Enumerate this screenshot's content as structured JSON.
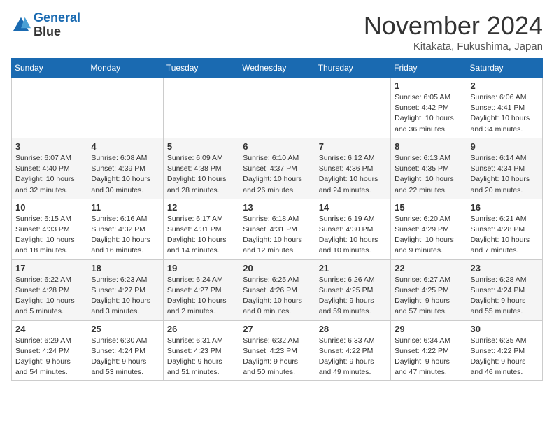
{
  "logo": {
    "line1": "General",
    "line2": "Blue"
  },
  "title": "November 2024",
  "location": "Kitakata, Fukushima, Japan",
  "days_of_week": [
    "Sunday",
    "Monday",
    "Tuesday",
    "Wednesday",
    "Thursday",
    "Friday",
    "Saturday"
  ],
  "weeks": [
    [
      {
        "day": "",
        "info": ""
      },
      {
        "day": "",
        "info": ""
      },
      {
        "day": "",
        "info": ""
      },
      {
        "day": "",
        "info": ""
      },
      {
        "day": "",
        "info": ""
      },
      {
        "day": "1",
        "info": "Sunrise: 6:05 AM\nSunset: 4:42 PM\nDaylight: 10 hours\nand 36 minutes."
      },
      {
        "day": "2",
        "info": "Sunrise: 6:06 AM\nSunset: 4:41 PM\nDaylight: 10 hours\nand 34 minutes."
      }
    ],
    [
      {
        "day": "3",
        "info": "Sunrise: 6:07 AM\nSunset: 4:40 PM\nDaylight: 10 hours\nand 32 minutes."
      },
      {
        "day": "4",
        "info": "Sunrise: 6:08 AM\nSunset: 4:39 PM\nDaylight: 10 hours\nand 30 minutes."
      },
      {
        "day": "5",
        "info": "Sunrise: 6:09 AM\nSunset: 4:38 PM\nDaylight: 10 hours\nand 28 minutes."
      },
      {
        "day": "6",
        "info": "Sunrise: 6:10 AM\nSunset: 4:37 PM\nDaylight: 10 hours\nand 26 minutes."
      },
      {
        "day": "7",
        "info": "Sunrise: 6:12 AM\nSunset: 4:36 PM\nDaylight: 10 hours\nand 24 minutes."
      },
      {
        "day": "8",
        "info": "Sunrise: 6:13 AM\nSunset: 4:35 PM\nDaylight: 10 hours\nand 22 minutes."
      },
      {
        "day": "9",
        "info": "Sunrise: 6:14 AM\nSunset: 4:34 PM\nDaylight: 10 hours\nand 20 minutes."
      }
    ],
    [
      {
        "day": "10",
        "info": "Sunrise: 6:15 AM\nSunset: 4:33 PM\nDaylight: 10 hours\nand 18 minutes."
      },
      {
        "day": "11",
        "info": "Sunrise: 6:16 AM\nSunset: 4:32 PM\nDaylight: 10 hours\nand 16 minutes."
      },
      {
        "day": "12",
        "info": "Sunrise: 6:17 AM\nSunset: 4:31 PM\nDaylight: 10 hours\nand 14 minutes."
      },
      {
        "day": "13",
        "info": "Sunrise: 6:18 AM\nSunset: 4:31 PM\nDaylight: 10 hours\nand 12 minutes."
      },
      {
        "day": "14",
        "info": "Sunrise: 6:19 AM\nSunset: 4:30 PM\nDaylight: 10 hours\nand 10 minutes."
      },
      {
        "day": "15",
        "info": "Sunrise: 6:20 AM\nSunset: 4:29 PM\nDaylight: 10 hours\nand 9 minutes."
      },
      {
        "day": "16",
        "info": "Sunrise: 6:21 AM\nSunset: 4:28 PM\nDaylight: 10 hours\nand 7 minutes."
      }
    ],
    [
      {
        "day": "17",
        "info": "Sunrise: 6:22 AM\nSunset: 4:28 PM\nDaylight: 10 hours\nand 5 minutes."
      },
      {
        "day": "18",
        "info": "Sunrise: 6:23 AM\nSunset: 4:27 PM\nDaylight: 10 hours\nand 3 minutes."
      },
      {
        "day": "19",
        "info": "Sunrise: 6:24 AM\nSunset: 4:27 PM\nDaylight: 10 hours\nand 2 minutes."
      },
      {
        "day": "20",
        "info": "Sunrise: 6:25 AM\nSunset: 4:26 PM\nDaylight: 10 hours\nand 0 minutes."
      },
      {
        "day": "21",
        "info": "Sunrise: 6:26 AM\nSunset: 4:25 PM\nDaylight: 9 hours\nand 59 minutes."
      },
      {
        "day": "22",
        "info": "Sunrise: 6:27 AM\nSunset: 4:25 PM\nDaylight: 9 hours\nand 57 minutes."
      },
      {
        "day": "23",
        "info": "Sunrise: 6:28 AM\nSunset: 4:24 PM\nDaylight: 9 hours\nand 55 minutes."
      }
    ],
    [
      {
        "day": "24",
        "info": "Sunrise: 6:29 AM\nSunset: 4:24 PM\nDaylight: 9 hours\nand 54 minutes."
      },
      {
        "day": "25",
        "info": "Sunrise: 6:30 AM\nSunset: 4:24 PM\nDaylight: 9 hours\nand 53 minutes."
      },
      {
        "day": "26",
        "info": "Sunrise: 6:31 AM\nSunset: 4:23 PM\nDaylight: 9 hours\nand 51 minutes."
      },
      {
        "day": "27",
        "info": "Sunrise: 6:32 AM\nSunset: 4:23 PM\nDaylight: 9 hours\nand 50 minutes."
      },
      {
        "day": "28",
        "info": "Sunrise: 6:33 AM\nSunset: 4:22 PM\nDaylight: 9 hours\nand 49 minutes."
      },
      {
        "day": "29",
        "info": "Sunrise: 6:34 AM\nSunset: 4:22 PM\nDaylight: 9 hours\nand 47 minutes."
      },
      {
        "day": "30",
        "info": "Sunrise: 6:35 AM\nSunset: 4:22 PM\nDaylight: 9 hours\nand 46 minutes."
      }
    ]
  ]
}
